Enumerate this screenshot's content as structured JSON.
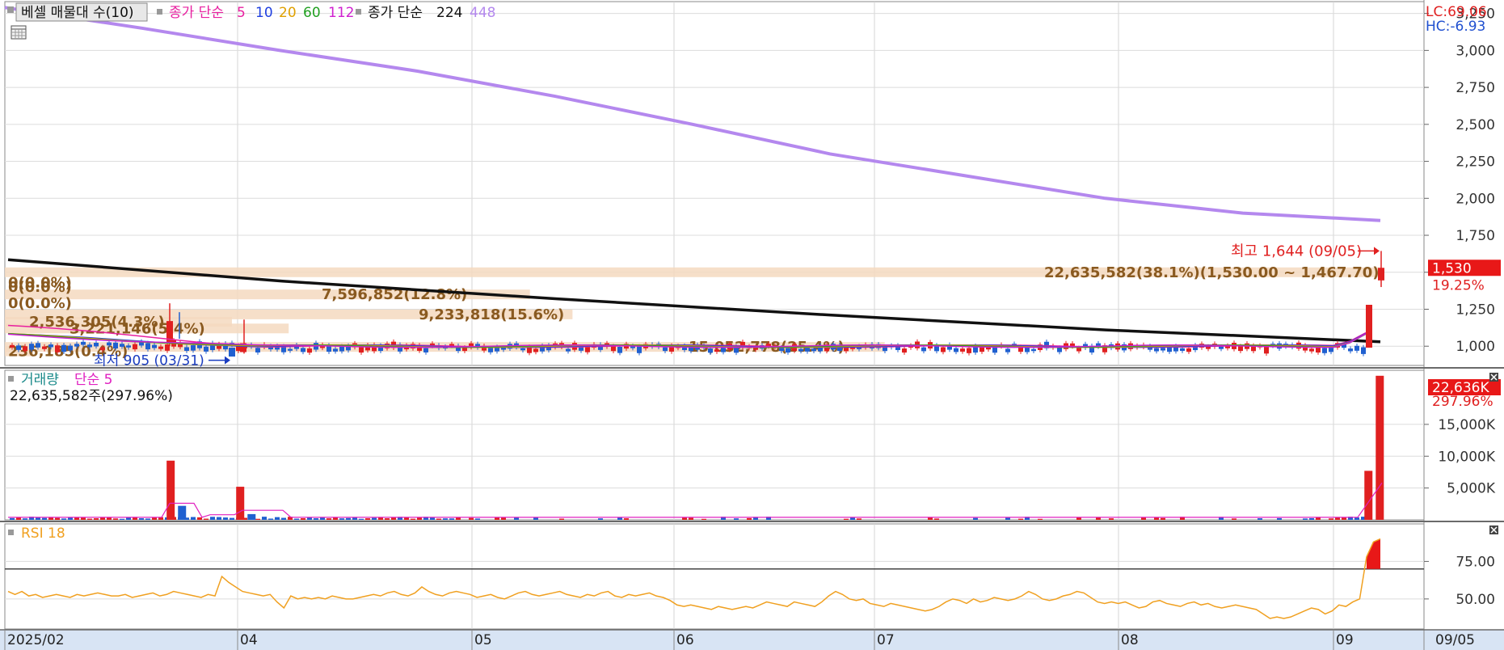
{
  "legend": {
    "sell_volume": "베셀 매물대 수(10)",
    "ma_prefix": "종가 단순",
    "ma_periods": [
      "5",
      "10",
      "20",
      "60",
      "112"
    ],
    "ma_colors": [
      "#e820a0",
      "#2040e0",
      "#e0a000",
      "#20a020",
      "#d020d0"
    ],
    "ma_long_prefix": "종가 단순",
    "ma_long_periods": [
      "224",
      "448"
    ],
    "ma_long_colors": [
      "#111111",
      "#b488ee"
    ]
  },
  "corner_info": {
    "lc": "LC:69.06",
    "hc": "HC:-6.93"
  },
  "chart_data": [
    {
      "type": "candlestick",
      "panel": "price",
      "x_tick_labels": [
        "2025/02",
        "04",
        "05",
        "06",
        "07",
        "08",
        "09"
      ],
      "right_date_label": "09/05",
      "y_tick_labels": [
        "3,250",
        "3,000",
        "2,750",
        "2,500",
        "2,250",
        "2,000",
        "1,750",
        "1,500",
        "1,250",
        "1,000"
      ],
      "ylim": [
        870,
        3330
      ],
      "ma448": {
        "x": [
          0,
          0.1,
          0.2,
          0.3,
          0.4,
          0.5,
          0.6,
          0.7,
          0.8,
          0.9,
          1.0
        ],
        "y": [
          3290,
          3150,
          3000,
          2860,
          2690,
          2500,
          2300,
          2150,
          2000,
          1900,
          1850
        ]
      },
      "ma224": {
        "x": [
          0,
          0.2,
          0.4,
          0.6,
          0.8,
          1.0
        ],
        "y": [
          1585,
          1440,
          1320,
          1210,
          1110,
          1030
        ]
      },
      "candles_summary": "most days trade flat around 1,000",
      "last_candle": {
        "open": 1280,
        "high": 1644,
        "low": 1400,
        "close": 1530
      },
      "high_note": "최고 1,644 (09/05)",
      "low_note": "최저 905 (03/31)",
      "current_price": "1,530",
      "current_change": "19.25%",
      "volume_profile": [
        {
          "label": "22,635,582(38.1%)(1,530.00 ~ 1,467.70)",
          "price": 1500
        },
        {
          "label": "0(0.0%)",
          "price": 1430
        },
        {
          "label": "0(0.0%)",
          "price": 1400
        },
        {
          "label": "7,596,852(12.8%)",
          "price": 1350
        },
        {
          "label": "0(0.0%)",
          "price": 1290
        },
        {
          "label": "9,233,818(15.6%)",
          "price": 1215
        },
        {
          "label": "2,536,305(4.3%)",
          "price": 1165
        },
        {
          "label": "3,221,146(5.4%)",
          "price": 1120
        },
        {
          "label": "15,052,778(25.4%)",
          "price": 995
        },
        {
          "label": "236,185(0.4%)",
          "price": 965
        }
      ]
    },
    {
      "type": "bar",
      "panel": "volume",
      "title": "거래량",
      "ma_label": "단순 5",
      "info": "22,635,582주(297.96%)",
      "y_tick_labels": [
        "15,000K",
        "10,000K",
        "5,000K"
      ],
      "current_value": "22,636K",
      "current_change": "297.96%",
      "ylim": [
        0,
        23500
      ],
      "spikes": [
        {
          "x": 0.114,
          "value": 9300,
          "color": "#e02020"
        },
        {
          "x": 0.122,
          "value": 2200,
          "color": "#2060d0"
        },
        {
          "x": 0.163,
          "value": 5200,
          "color": "#e02020"
        },
        {
          "x": 0.171,
          "value": 900,
          "color": "#2060d0"
        },
        {
          "x": 0.958,
          "value": 7700,
          "color": "#e02020"
        },
        {
          "x": 0.966,
          "value": 22636,
          "color": "#e02020"
        }
      ]
    },
    {
      "type": "line",
      "panel": "rsi",
      "title": "RSI 18",
      "y_tick_labels": [
        "75.00",
        "50.00"
      ],
      "ylim": [
        30,
        100
      ],
      "threshold": 70,
      "values": [
        55,
        53,
        55,
        52,
        53,
        51,
        52,
        53,
        52,
        51,
        53,
        52,
        53,
        54,
        53,
        52,
        52,
        53,
        51,
        52,
        53,
        54,
        52,
        53,
        55,
        54,
        53,
        52,
        51,
        53,
        52,
        65,
        61,
        58,
        55,
        54,
        53,
        52,
        53,
        48,
        44,
        52,
        50,
        51,
        50,
        51,
        50,
        52,
        51,
        50,
        50,
        51,
        52,
        53,
        52,
        54,
        55,
        53,
        52,
        54,
        58,
        55,
        53,
        52,
        54,
        55,
        54,
        53,
        51,
        52,
        53,
        51,
        50,
        52,
        54,
        55,
        53,
        52,
        53,
        54,
        55,
        53,
        52,
        51,
        53,
        52,
        54,
        55,
        52,
        51,
        53,
        52,
        53,
        54,
        52,
        51,
        49,
        46,
        45,
        46,
        45,
        44,
        43,
        45,
        44,
        43,
        44,
        45,
        44,
        46,
        48,
        47,
        46,
        45,
        48,
        47,
        46,
        45,
        48,
        52,
        55,
        53,
        50,
        49,
        50,
        47,
        46,
        45,
        47,
        46,
        45,
        44,
        43,
        42,
        43,
        45,
        48,
        50,
        49,
        47,
        50,
        48,
        49,
        51,
        50,
        49,
        50,
        52,
        55,
        53,
        50,
        49,
        50,
        52,
        53,
        55,
        54,
        51,
        48,
        47,
        48,
        47,
        48,
        46,
        44,
        45,
        48,
        49,
        47,
        46,
        45,
        47,
        48,
        46,
        47,
        45,
        44,
        45,
        46,
        45,
        44,
        43,
        40,
        37,
        38,
        37,
        38,
        40,
        42,
        44,
        43,
        40,
        42,
        46,
        45,
        48,
        50,
        78,
        88,
        90
      ]
    }
  ]
}
